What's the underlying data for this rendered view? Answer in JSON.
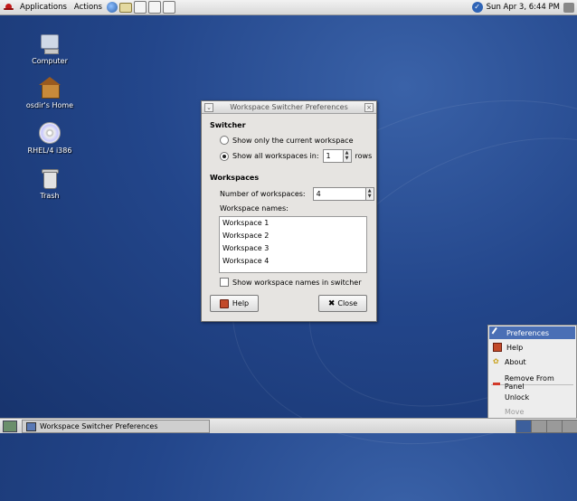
{
  "top_panel": {
    "applications": "Applications",
    "actions": "Actions",
    "launcher_icons": [
      "globe-icon",
      "mail-icon",
      "writer-icon",
      "impress-icon",
      "calc-icon"
    ],
    "clock": "Sun Apr  3,  6:44 PM"
  },
  "desktop_icons": [
    {
      "label": "Computer",
      "icon": "computer-icon"
    },
    {
      "label": "osdir's Home",
      "icon": "home-folder-icon"
    },
    {
      "label": "RHEL/4 i386",
      "icon": "cd-icon"
    },
    {
      "label": "Trash",
      "icon": "trash-icon"
    }
  ],
  "dialog": {
    "title": "Workspace Switcher Preferences",
    "switcher_header": "Switcher",
    "radio_current": "Show only the current workspace",
    "radio_all": "Show all workspaces in:",
    "rows_value": "1",
    "rows_suffix": "rows",
    "workspaces_header": "Workspaces",
    "num_label": "Number of workspaces:",
    "num_value": "4",
    "names_label": "Workspace names:",
    "names": [
      "Workspace 1",
      "Workspace 2",
      "Workspace 3",
      "Workspace 4"
    ],
    "show_names_label": "Show workspace names in switcher",
    "help_button": "Help",
    "close_button": "Close"
  },
  "context_menu": {
    "items": [
      "Preferences",
      "Help",
      "About",
      "Remove From Panel",
      "Unlock",
      "Move"
    ]
  },
  "bottom_panel": {
    "task_label": "Workspace Switcher Preferences",
    "workspaces_count": 4,
    "active_workspace": 1
  },
  "colors": {
    "desktop": "#23468b",
    "menu_highlight": "#4a6fb5"
  }
}
